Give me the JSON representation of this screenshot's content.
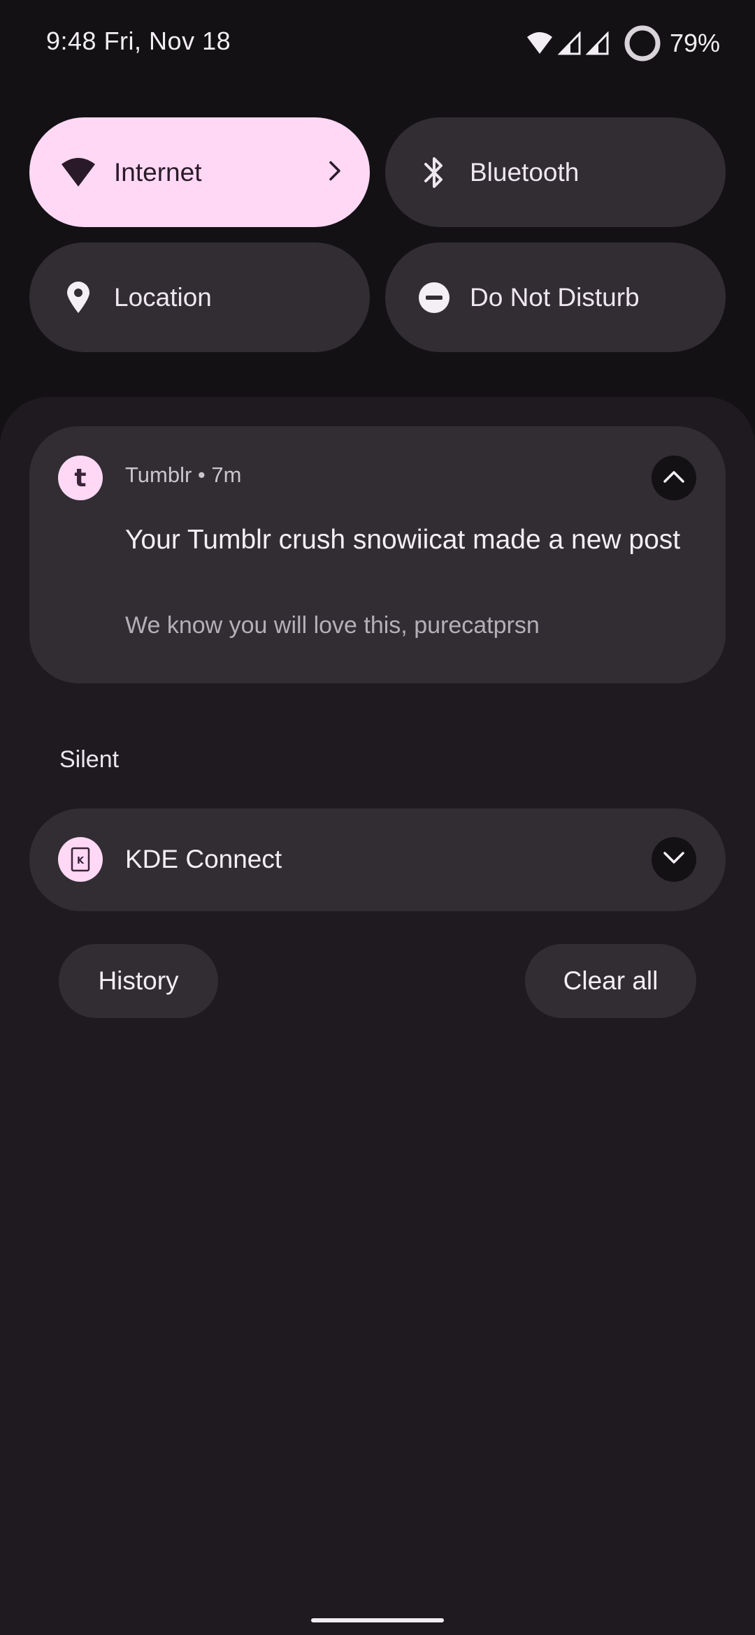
{
  "status_bar": {
    "time_date": "9:48 Fri, Nov 18",
    "battery_percent": "79%",
    "icons": [
      "wifi-icon",
      "cell-signal-icon",
      "cell-signal-icon",
      "battery-ring-icon"
    ]
  },
  "quick_settings": {
    "tiles": [
      {
        "label": "Internet",
        "icon": "wifi-icon",
        "active": true
      },
      {
        "label": "Bluetooth",
        "icon": "bluetooth-icon",
        "active": false
      },
      {
        "label": "Location",
        "icon": "location-pin-icon",
        "active": false
      },
      {
        "label": "Do Not Disturb",
        "icon": "do-not-disturb-icon",
        "active": false
      }
    ]
  },
  "notifications": {
    "tumblr": {
      "app_initial": "t",
      "header": "Tumblr • 7m",
      "title": "Your Tumblr crush snowiicat made a new post",
      "text": "We know you will love this, purecatprsn"
    },
    "silent_section": "Silent",
    "kde": {
      "label": "KDE Connect",
      "icon_letter": "K"
    }
  },
  "actions": {
    "history": "History",
    "clear_all": "Clear all"
  },
  "colors": {
    "active_tile": "#ffd8f5",
    "tile": "#312d33",
    "background": "#131114",
    "shade": "#1e1a1f"
  }
}
